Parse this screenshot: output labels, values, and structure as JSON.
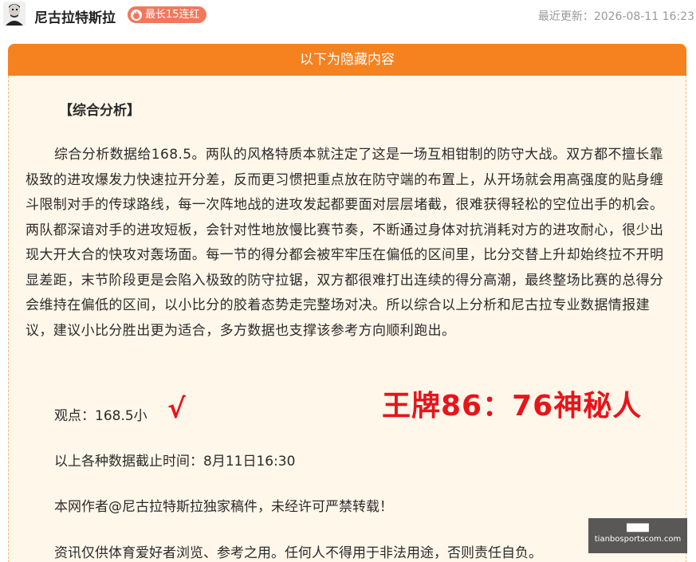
{
  "author": {
    "name": "尼古拉特斯拉",
    "streak_badge": "最长15连红"
  },
  "updated": "最近更新：2026-08-11 16:23",
  "hidden_section": {
    "header": "以下为隐藏内容",
    "title": "【综合分析】",
    "analysis": "综合分析数据给168.5。两队的风格特质本就注定了这是一场互相钳制的防守大战。双方都不擅长靠极致的进攻爆发力快速拉开分差，反而更习惯把重点放在防守端的布置上，从开场就会用高强度的贴身缠斗限制对手的传球路线，每一次阵地战的进攻发起都要面对层层堵截，很难获得轻松的空位出手的机会。两队都深谙对手的进攻短板，会针对性地放慢比赛节奏，不断通过身体对抗消耗对方的进攻耐心，很少出现大开大合的快攻对轰场面。每一节的得分都会被牢牢压在偏低的区间里，比分交替上升却始终拉不开明显差距，末节阶段更是会陷入极致的防守拉锯，双方都很难打出连续的得分高潮，最终整场比赛的总得分会维持在偏低的区间，以小比分的胶着态势走完整场对决。所以综合以上分析和尼古拉专业数据情报建议，建议小比分胜出更为适合，多方数据也支撑该参考方向顺利跑出。",
    "opinion": "观点：168.5小",
    "check_mark": "√",
    "score_note": "王牌86：76神秘人",
    "cutoff": "以上各种数据截止时间：8月11日16:30",
    "copyright": "本网作者@尼古拉特斯拉独家稿件，未经许可严禁转载！",
    "disclaimer": "资讯仅供体育爱好者浏览、参考之用。任何人不得用于非法用途，否则责任自负。"
  },
  "watermark": {
    "title": "████",
    "site": "tianbosportscom.com"
  },
  "colors": {
    "header_orange": "#f5811f",
    "badge_orange": "#f3775b",
    "card_bg": "#fff7ea",
    "score_red": "#e8141b"
  }
}
